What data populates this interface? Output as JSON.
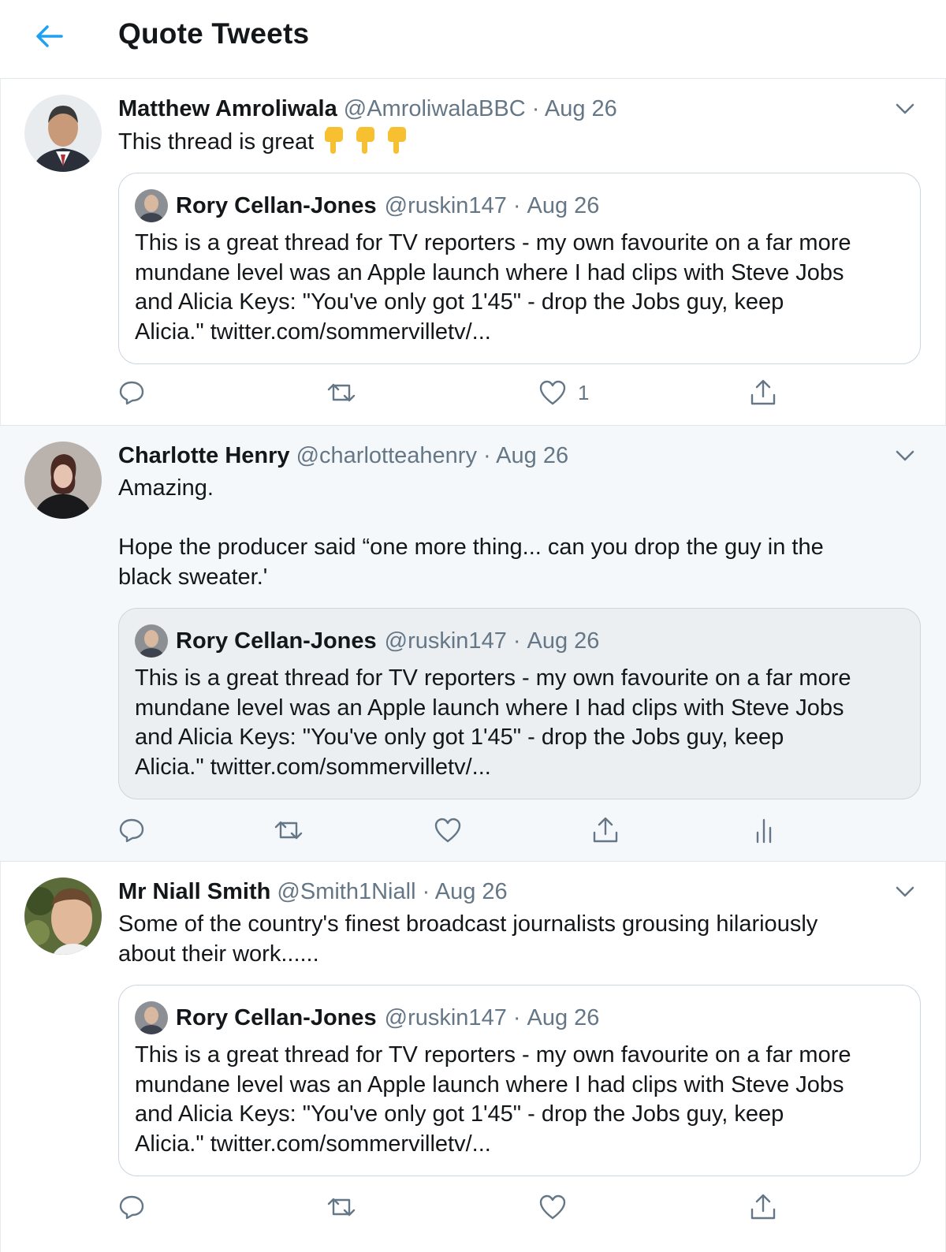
{
  "header": {
    "title": "Quote Tweets",
    "back_icon": "arrow-left-icon",
    "accent": "#1da1f2"
  },
  "quoted_tweet": {
    "name": "Rory Cellan-Jones",
    "handle": "@ruskin147",
    "date": "Aug 26",
    "line1": "This is a great thread for TV reporters - my own favourite on a far more",
    "line2": "mundane level was an Apple launch where I had clips with Steve Jobs",
    "line3": "and Alicia Keys: \"You've only got 1'45\" - drop the Jobs guy, keep",
    "line4": "Alicia.\" twitter.com/sommervilletv/..."
  },
  "tweets": [
    {
      "name": "Matthew Amroliwala",
      "handle": "@AmroliwalaBBC",
      "date": "Aug 26",
      "text": "This thread is great",
      "emoji": "point-down-emoji",
      "like_count": "1"
    },
    {
      "name": "Charlotte Henry",
      "handle": "@charlotteahenry",
      "date": "Aug 26",
      "text_line1": "Amazing.",
      "text_line2": "Hope the producer said “one more thing... can you drop the guy in the",
      "text_line3": "black sweater.'"
    },
    {
      "name": "Mr Niall Smith",
      "handle": "@Smith1Niall",
      "date": "Aug 26",
      "text_line1": "Some of the country's finest broadcast journalists grousing hilariously",
      "text_line2": "about their work......"
    }
  ],
  "separator": "·",
  "icons": [
    "reply-icon",
    "retweet-icon",
    "like-icon",
    "share-icon",
    "analytics-icon",
    "chevron-down-icon"
  ],
  "colors": {
    "text": "#14171a",
    "muted": "#657786",
    "border": "#ccd6dd",
    "highlight_bg": "#f5f8fa"
  }
}
